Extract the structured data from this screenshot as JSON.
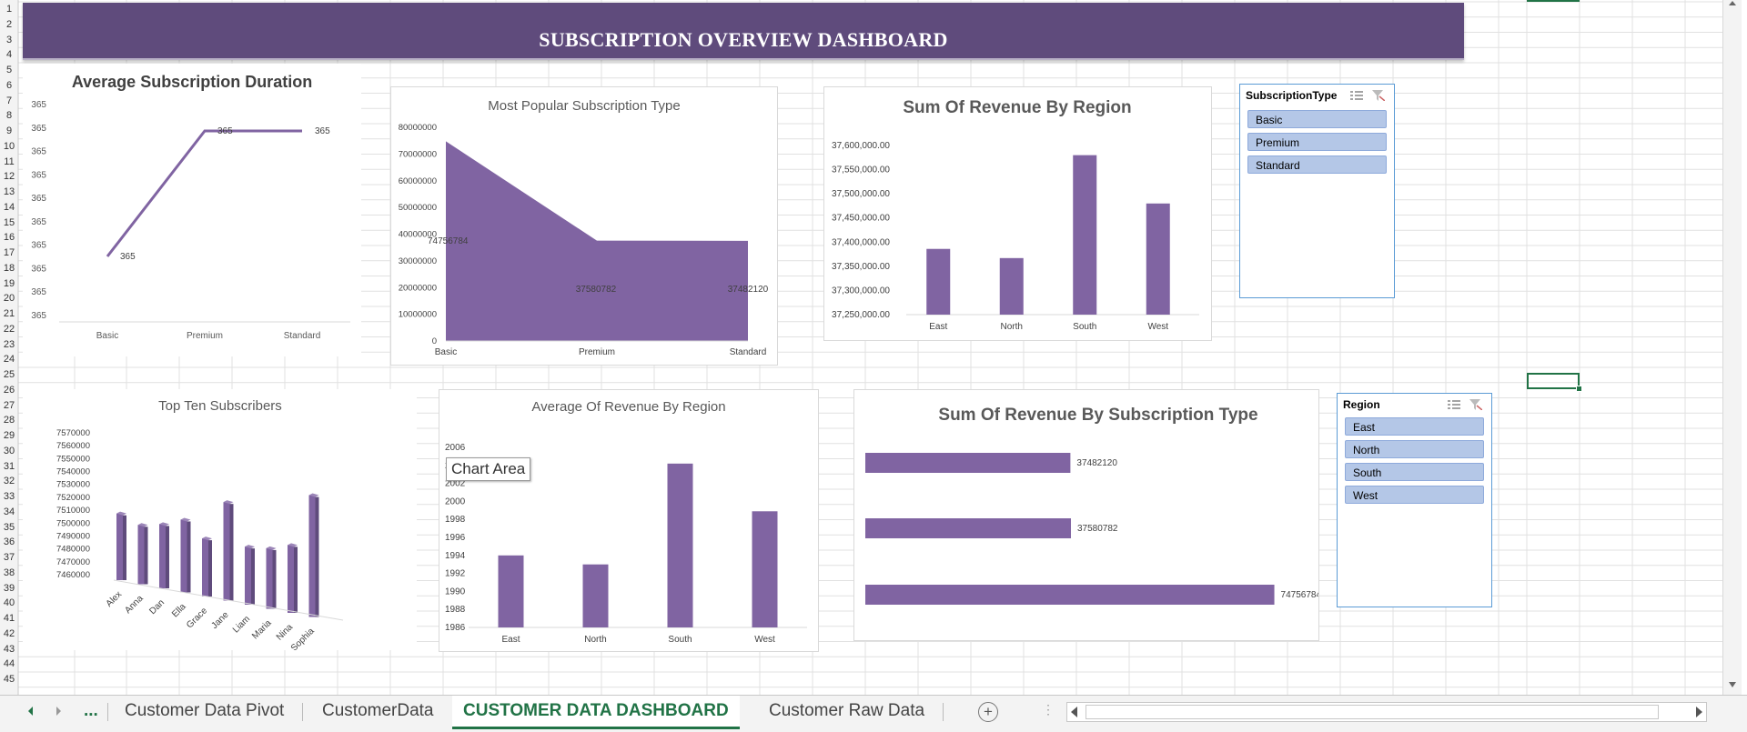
{
  "sheet": {
    "row_numbers": [
      "1",
      "2",
      "3",
      "4",
      "5",
      "6",
      "7",
      "8",
      "9",
      "10",
      "11",
      "12",
      "13",
      "14",
      "15",
      "16",
      "17",
      "18",
      "19",
      "20",
      "21",
      "22",
      "23",
      "24",
      "25",
      "26",
      "27",
      "28",
      "29",
      "30",
      "31",
      "32",
      "33",
      "34",
      "35",
      "36",
      "37",
      "38",
      "39",
      "40",
      "41",
      "42",
      "43",
      "44",
      "45"
    ]
  },
  "dashboard": {
    "title": "SUBSCRIPTION OVERVIEW DASHBOARD",
    "accent_color": "#5f4b7c",
    "series_color": "#8064a2"
  },
  "tooltip": {
    "text": "Chart Area"
  },
  "chart_data": [
    {
      "id": "avg-duration",
      "type": "line",
      "title": "Average Subscription Duration",
      "categories": [
        "Basic",
        "Premium",
        "Standard"
      ],
      "values": [
        365,
        365,
        365
      ],
      "data_labels": [
        "365",
        "365",
        "365"
      ],
      "y_tick_labels": [
        "365",
        "365",
        "365",
        "365",
        "365",
        "365",
        "365",
        "365",
        "365",
        "365"
      ]
    },
    {
      "id": "popular-type",
      "type": "area",
      "title": "Most Popular Subscription Type",
      "categories": [
        "Basic",
        "Premium",
        "Standard"
      ],
      "values": [
        74756784,
        37580782,
        37482120
      ],
      "data_labels": [
        "74756784",
        "37580782",
        "37482120"
      ],
      "ylim": [
        0,
        80000000
      ],
      "y_tick_labels": [
        "80000000",
        "70000000",
        "60000000",
        "50000000",
        "40000000",
        "30000000",
        "20000000",
        "10000000",
        "0"
      ]
    },
    {
      "id": "revenue-region",
      "type": "bar",
      "title": "Sum Of Revenue By Region",
      "categories": [
        "East",
        "North",
        "South",
        "West"
      ],
      "values": [
        37386000,
        37367000,
        37580000,
        37480000
      ],
      "ylim": [
        37250000,
        37600000
      ],
      "y_tick_labels": [
        "37,600,000.00",
        "37,550,000.00",
        "37,500,000.00",
        "37,450,000.00",
        "37,400,000.00",
        "37,350,000.00",
        "37,300,000.00",
        "37,250,000.00"
      ]
    },
    {
      "id": "top-ten",
      "type": "bar",
      "title": "Top Ten Subscribers",
      "categories": [
        "Alex",
        "Anna",
        "Dan",
        "Ella",
        "Grace",
        "Jane",
        "Liam",
        "Maria",
        "Nina",
        "Sophia"
      ],
      "values": [
        7507000,
        7501000,
        7505000,
        7512000,
        7500000,
        7533000,
        7500000,
        7502000,
        7508000,
        7552000
      ],
      "ylim": [
        7460000,
        7570000
      ],
      "y_tick_labels": [
        "7570000",
        "7560000",
        "7550000",
        "7540000",
        "7530000",
        "7520000",
        "7510000",
        "7500000",
        "7490000",
        "7480000",
        "7470000",
        "7460000"
      ]
    },
    {
      "id": "avg-revenue-region",
      "type": "bar",
      "title": "Average Of Revenue By Region",
      "categories": [
        "East",
        "North",
        "South",
        "West"
      ],
      "values": [
        1994.0,
        1993.0,
        2004.2,
        1998.9
      ],
      "ylim": [
        1986,
        2006
      ],
      "y_tick_labels": [
        "2006",
        "2004",
        "2002",
        "2000",
        "1998",
        "1996",
        "1994",
        "1992",
        "1990",
        "1988",
        "1986"
      ]
    },
    {
      "id": "revenue-type",
      "type": "bar",
      "title": "Sum Of Revenue By Subscription Type",
      "categories": [
        "Standard",
        "Premium",
        "Basic"
      ],
      "values": [
        37482120,
        37580782,
        74756784
      ],
      "data_labels": [
        "37482120",
        "37580782",
        "74756784"
      ],
      "xlim": [
        0,
        75000000
      ]
    }
  ],
  "slicers": {
    "subscription_type": {
      "header": "SubscriptionType",
      "items": [
        "Basic",
        "Premium",
        "Standard"
      ]
    },
    "region": {
      "header": "Region",
      "items": [
        "East",
        "North",
        "South",
        "West"
      ]
    }
  },
  "tabs": {
    "more": "...",
    "items": [
      "Customer Data Pivot",
      "CustomerData",
      "CUSTOMER DATA DASHBOARD",
      "Customer Raw Data"
    ],
    "active": "CUSTOMER DATA DASHBOARD"
  }
}
